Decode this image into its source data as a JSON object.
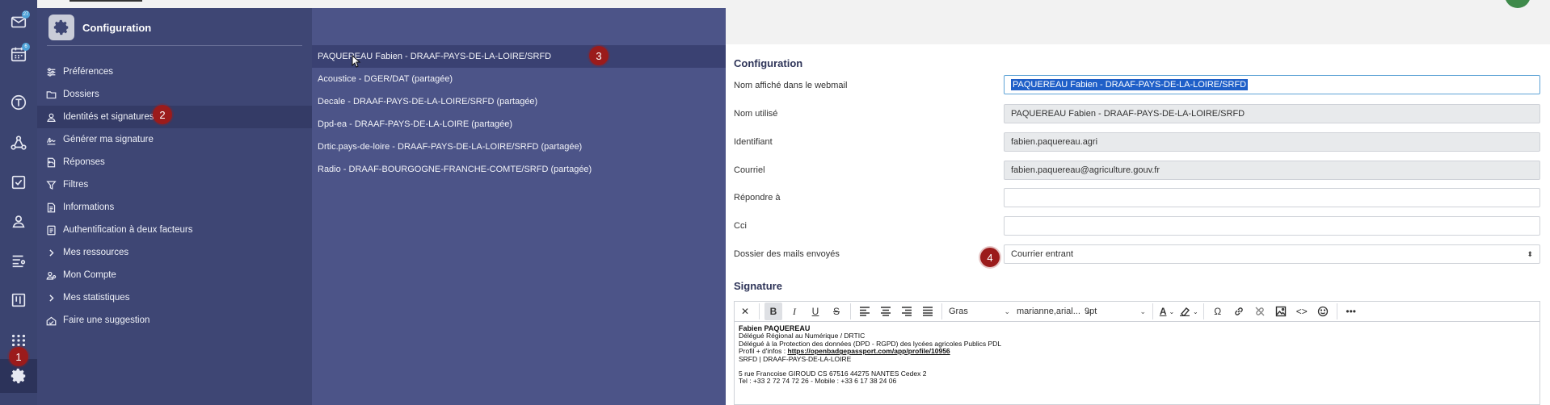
{
  "rail": {
    "icons": [
      {
        "name": "mail-icon",
        "badge": "27"
      },
      {
        "name": "calendar-icon",
        "badge": "6"
      },
      {
        "name": "tasks-t-icon",
        "badge": ""
      },
      {
        "name": "share-icon",
        "badge": ""
      },
      {
        "name": "checkbox-icon",
        "badge": ""
      },
      {
        "name": "contacts-icon",
        "badge": ""
      },
      {
        "name": "list-icon",
        "badge": ""
      },
      {
        "name": "board-icon",
        "badge": ""
      },
      {
        "name": "apps-grid-icon",
        "badge": ""
      },
      {
        "name": "settings-gear-icon",
        "badge": ""
      }
    ]
  },
  "menu": {
    "title": "Configuration",
    "items": [
      {
        "label": "Préférences",
        "icon": "sliders-icon"
      },
      {
        "label": "Dossiers",
        "icon": "folder-icon"
      },
      {
        "label": "Identités et signatures",
        "icon": "user-icon"
      },
      {
        "label": "Générer ma signature",
        "icon": "signature-icon"
      },
      {
        "label": "Réponses",
        "icon": "reply-doc-icon"
      },
      {
        "label": "Filtres",
        "icon": "filter-icon"
      },
      {
        "label": "Informations",
        "icon": "info-doc-icon"
      },
      {
        "label": "Authentification à deux facteurs",
        "icon": "two-factor-icon"
      },
      {
        "label": "Mes ressources",
        "icon": "chevron-right-icon"
      },
      {
        "label": "Mon Compte",
        "icon": "account-icon"
      },
      {
        "label": "Mes statistiques",
        "icon": "chevron-right-icon"
      },
      {
        "label": "Faire une suggestion",
        "icon": "suggestion-icon"
      }
    ]
  },
  "identities": [
    "PAQUEREAU Fabien - DRAAF-PAYS-DE-LA-LOIRE/SRFD",
    "Acoustice - DGER/DAT (partagée)",
    "Decale - DRAAF-PAYS-DE-LA-LOIRE/SRFD (partagée)",
    "Dpd-ea - DRAAF-PAYS-DE-LA-LOIRE (partagée)",
    "Drtic.pays-de-loire - DRAAF-PAYS-DE-LA-LOIRE/SRFD (partagée)",
    "Radio - DRAAF-BOURGOGNE-FRANCHE-COMTE/SRFD (partagée)"
  ],
  "form": {
    "section_title": "Configuration",
    "display_name_label": "Nom affiché dans le webmail",
    "display_name_value": "PAQUEREAU Fabien - DRAAF-PAYS-DE-LA-LOIRE/SRFD",
    "used_name_label": "Nom utilisé",
    "used_name_value": "PAQUEREAU Fabien - DRAAF-PAYS-DE-LA-LOIRE/SRFD",
    "identifier_label": "Identifiant",
    "identifier_value": "fabien.paquereau.agri",
    "email_label": "Courriel",
    "email_value": "fabien.paquereau@agriculture.gouv.fr",
    "reply_to_label": "Répondre à",
    "reply_to_value": "",
    "bcc_label": "Cci",
    "bcc_value": "",
    "sent_folder_label": "Dossier des mails envoyés",
    "sent_folder_value": "Courrier entrant"
  },
  "signature": {
    "section_title": "Signature",
    "toolbar": {
      "format": "Gras",
      "font": "marianne,arial...",
      "size": "9pt"
    },
    "lines": {
      "name": "Fabien PAQUEREAU",
      "l1": "Délégué Régional au Numérique / DRTIC",
      "l2": "Délégué à la Protection des données (DPD - RGPD) des lycées agricoles Publics PDL",
      "l3_prefix": "Profil + d'infos : ",
      "l3_link": "https://openbadgepassport.com/app/profile/10956",
      "l4": "SRFD | DRAAF-PAYS-DE-LA-LOIRE",
      "l5": "5 rue Francoise GIROUD CS 67516 44275 NANTES Cedex 2",
      "l6": "Tel : +33 2 72 74 72 26 - Mobile : +33 6 17 38 24 06"
    }
  },
  "steps": [
    "1",
    "2",
    "3",
    "4"
  ],
  "colors": {
    "rail": "#3b4470",
    "menu": "#3e4674",
    "identity_list": "#4c5488",
    "step_marker": "#9b1b1b",
    "selection": "#1f5fc8"
  }
}
